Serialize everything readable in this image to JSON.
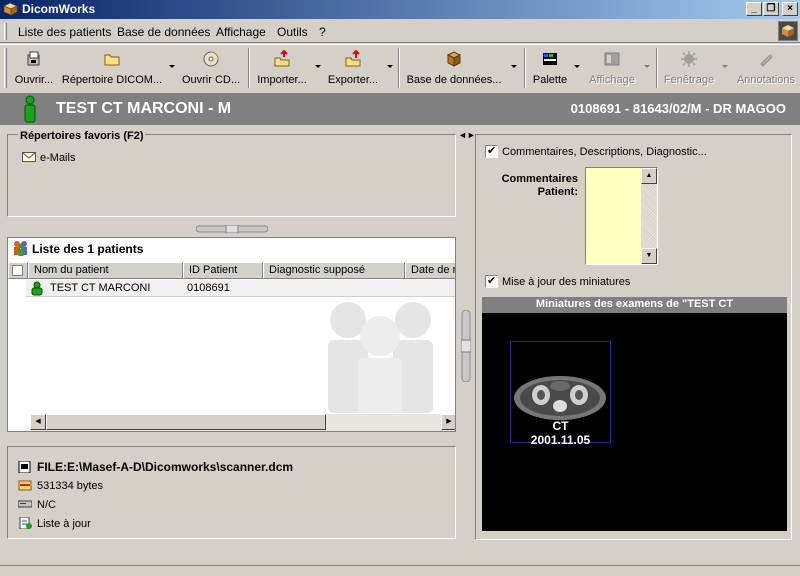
{
  "window": {
    "title": "DicomWorks",
    "icon": "app-box-icon",
    "buttons": [
      "minimize",
      "restore",
      "close"
    ]
  },
  "menu": [
    {
      "label": "Liste des patients"
    },
    {
      "label": "Base de données"
    },
    {
      "label": "Affichage"
    },
    {
      "label": "Outils"
    },
    {
      "label": "?"
    }
  ],
  "toolbar": {
    "buttons": [
      {
        "label": "Ouvrir...",
        "icon": "open-file-icon",
        "enabled": true
      },
      {
        "label": "Répertoire DICOM...",
        "icon": "folder-icon",
        "enabled": true,
        "dropdown": true
      },
      {
        "label": "Ouvrir CD...",
        "icon": "cd-icon",
        "enabled": true
      },
      {
        "label": "Importer...",
        "icon": "import-icon",
        "enabled": true,
        "dropdown": true
      },
      {
        "label": "Exporter...",
        "icon": "export-icon",
        "enabled": true,
        "dropdown": true
      },
      {
        "label": "Base de données...",
        "icon": "database-icon",
        "enabled": true,
        "dropdown": true
      },
      {
        "label": "Palette",
        "icon": "palette-icon",
        "enabled": true,
        "dropdown": true
      },
      {
        "label": "Affichage",
        "icon": "display-icon",
        "enabled": false,
        "dropdown": true
      },
      {
        "label": "Fenêtrage",
        "icon": "windowing-icon",
        "enabled": false,
        "dropdown": true
      },
      {
        "label": "Annotations",
        "icon": "annotations-icon",
        "enabled": false
      }
    ]
  },
  "patient_header": {
    "name": "TEST CT MARCONI - M",
    "info": "0108691 - 81643/02/M - DR MAGOO"
  },
  "favorites": {
    "title": "Répertoires favoris (F2)",
    "items": [
      {
        "label": "e-Mails",
        "icon": "mail-icon"
      }
    ]
  },
  "patient_list": {
    "title": "Liste des 1 patients",
    "columns": [
      "Nom du patient",
      "ID Patient",
      "Diagnostic supposé",
      "Date de n"
    ],
    "rows": [
      {
        "name": "TEST CT MARCONI",
        "id": "0108691",
        "diagnostic": "",
        "date": ""
      }
    ]
  },
  "file_info": {
    "path": "FILE:E:\\Masef-A-D\\Dicomworks\\scanner.dcm",
    "size": "531334 bytes",
    "drive": "N/C",
    "status": "Liste à jour"
  },
  "right_panel": {
    "comments_checkbox": "Commentaires, Descriptions, Diagnostic...",
    "comments_checked": true,
    "comment_label": "Commentaires Patient:",
    "comment_value": "",
    "thumbnails_checkbox": "Mise à jour des miniatures",
    "thumbnails_checked": true,
    "thumbnails_title": "Miniatures des examens de \"TEST CT",
    "thumbnail": {
      "modality": "CT",
      "date": "2001.11.05"
    }
  },
  "colors": {
    "titlebar_start": "#0a246a",
    "titlebar_end": "#a6caf0",
    "header_bg": "#808080",
    "comment_bg": "#ffffc0",
    "person_green": "#1aa31a"
  }
}
